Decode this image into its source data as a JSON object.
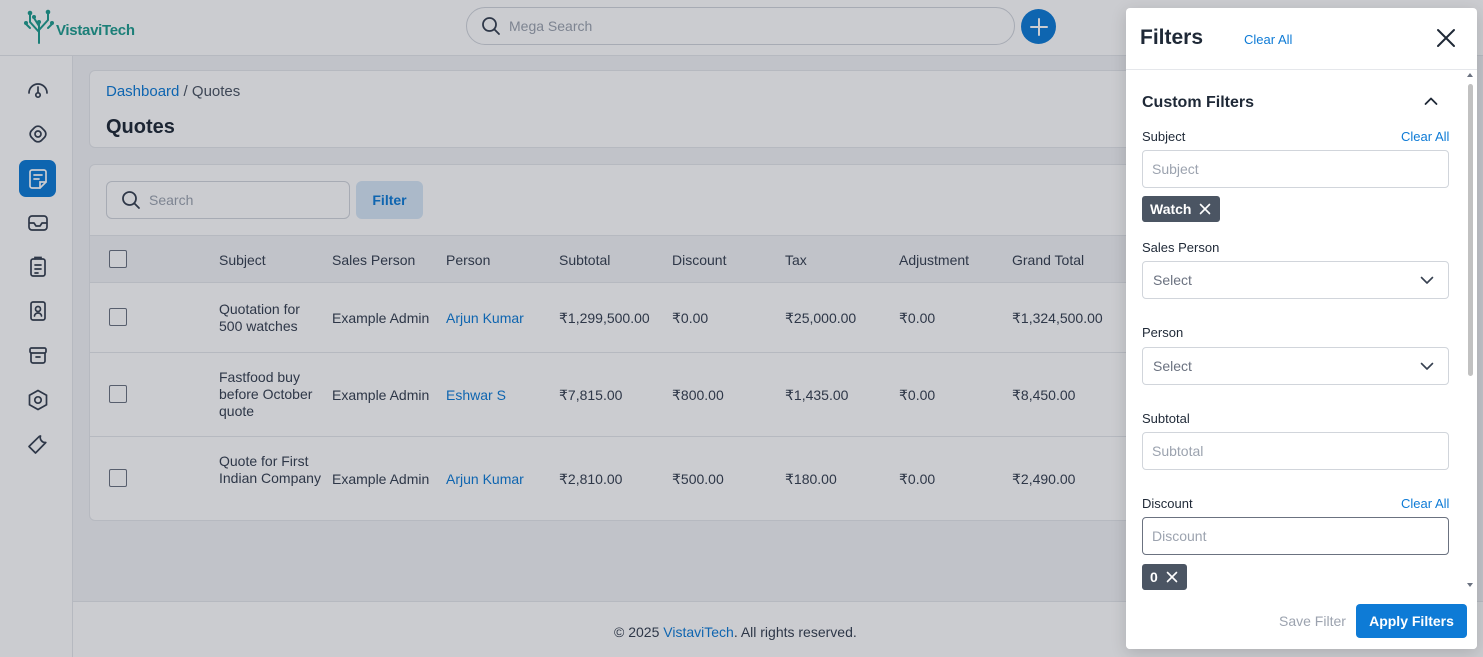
{
  "app": {
    "brand": "VistaviTech",
    "accent_color": "#0e7bd6"
  },
  "header": {
    "mega_search_placeholder": "Mega Search",
    "icons": [
      "search-icon",
      "plus-icon"
    ]
  },
  "sidebar": {
    "items": [
      {
        "name": "dashboard",
        "icon": "gauge-icon",
        "active": false
      },
      {
        "name": "leads",
        "icon": "leads-icon",
        "active": false
      },
      {
        "name": "quotes",
        "icon": "quote-icon",
        "active": true
      },
      {
        "name": "mail",
        "icon": "mail-icon",
        "active": false
      },
      {
        "name": "activities",
        "icon": "clipboard-icon",
        "active": false
      },
      {
        "name": "contacts",
        "icon": "contact-icon",
        "active": false
      },
      {
        "name": "products",
        "icon": "box-icon",
        "active": false
      },
      {
        "name": "settings",
        "icon": "settings-icon",
        "active": false
      },
      {
        "name": "configuration",
        "icon": "wrench-icon",
        "active": false
      }
    ]
  },
  "page": {
    "breadcrumb_home": "Dashboard",
    "breadcrumb_sep": " / ",
    "breadcrumb_current": "Quotes",
    "title": "Quotes",
    "search_placeholder": "Search",
    "filter_label": "Filter"
  },
  "table": {
    "columns": [
      "Subject",
      "Sales Person",
      "Person",
      "Subtotal",
      "Discount",
      "Tax",
      "Adjustment",
      "Grand Total"
    ],
    "rows": [
      {
        "subject": "Quotation for 500 watches",
        "sales_person": "Example Admin",
        "person": "Arjun Kumar",
        "subtotal": "₹1,299,500.00",
        "discount": "₹0.00",
        "tax": "₹25,000.00",
        "adjustment": "₹0.00",
        "grand_total": "₹1,324,500.00"
      },
      {
        "subject": "Fastfood buy before October quote",
        "sales_person": "Example Admin",
        "person": "Eshwar S",
        "subtotal": "₹7,815.00",
        "discount": "₹800.00",
        "tax": "₹1,435.00",
        "adjustment": "₹0.00",
        "grand_total": "₹8,450.00"
      },
      {
        "subject": "Quote for First Indian Company",
        "sales_person": "Example Admin",
        "person": "Arjun Kumar",
        "subtotal": "₹2,810.00",
        "discount": "₹500.00",
        "tax": "₹180.00",
        "adjustment": "₹0.00",
        "grand_total": "₹2,490.00"
      }
    ]
  },
  "footer": {
    "prefix": "© 2025 ",
    "brand_link": "VistaviTech",
    "suffix": ". All rights reserved."
  },
  "filters": {
    "title": "Filters",
    "clear_all": "Clear All",
    "section_title": "Custom Filters",
    "subject": {
      "label": "Subject",
      "clear": "Clear All",
      "placeholder": "Subject",
      "chip": "Watch"
    },
    "sales_person": {
      "label": "Sales Person",
      "value": "Select"
    },
    "person": {
      "label": "Person",
      "value": "Select"
    },
    "subtotal": {
      "label": "Subtotal",
      "placeholder": "Subtotal"
    },
    "discount": {
      "label": "Discount",
      "clear": "Clear All",
      "placeholder": "Discount",
      "chip": "0"
    },
    "save_filter": "Save Filter",
    "apply_filters": "Apply Filters"
  }
}
